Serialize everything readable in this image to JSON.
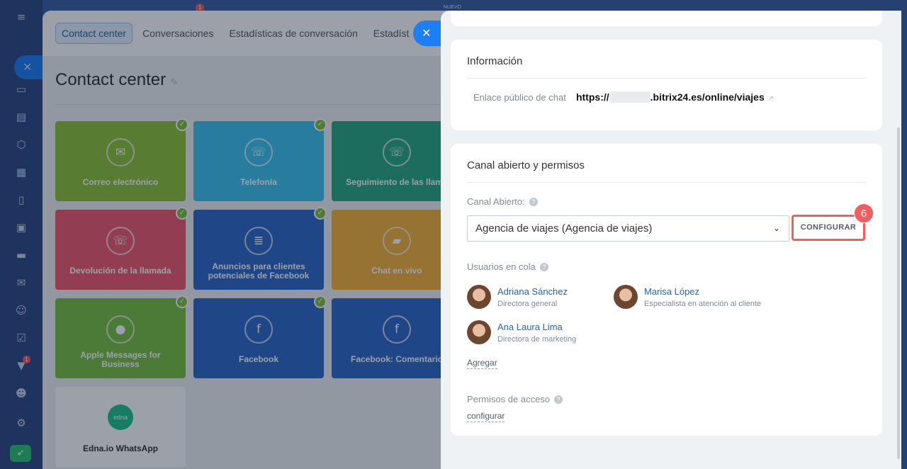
{
  "leftnav": {
    "icons": [
      "menu-icon",
      "close-icon",
      "chat-icon",
      "list-icon",
      "hexagon-icon",
      "calendar-icon",
      "document-icon",
      "projector-icon",
      "card-icon",
      "mail-icon",
      "contacts-icon",
      "check-icon",
      "filter-icon",
      "robot-icon",
      "settings-icon",
      "rocket-icon"
    ],
    "badge": "1"
  },
  "topbar": {
    "badge": "1",
    "new_label": "NUEVO"
  },
  "bg": {
    "tabs": [
      "Contact center",
      "Conversaciones",
      "Estadísticas de conversación",
      "Estadíst"
    ],
    "title": "Contact center",
    "tiles": [
      {
        "label": "Correo electrónico",
        "icon": "✉",
        "checked": true
      },
      {
        "label": "Telefonía",
        "icon": "☏",
        "checked": true
      },
      {
        "label": "Seguimiento de las llama",
        "icon": "☏",
        "checked": false
      },
      {
        "label": "Devolución de la llamada",
        "icon": "☏",
        "checked": true
      },
      {
        "label": "Anuncios para clientes potenciales de Facebook",
        "icon": "≣",
        "checked": true
      },
      {
        "label": "Chat en vivo",
        "icon": "▰",
        "checked": false
      },
      {
        "label": "Apple Messages for Business",
        "icon": "●",
        "checked": true
      },
      {
        "label": "Facebook",
        "icon": "f",
        "checked": true
      },
      {
        "label": "Facebook: Comentario",
        "icon": "f",
        "checked": false
      },
      {
        "label": "Edna.io WhatsApp",
        "icon": "edna",
        "checked": false
      }
    ],
    "edna_logo_text": "edna"
  },
  "slider": {
    "info": {
      "title": "Información",
      "link_label": "Enlace público de chat",
      "link_prefix": "https://",
      "link_suffix": ".bitrix24.es/online/viajes"
    },
    "channel": {
      "title": "Canal abierto y permisos",
      "canal_label": "Canal Abierto:",
      "canal_value": "Agencia de viajes (Agencia de viajes)",
      "configure_button": "CONFIGURAR",
      "step_number": "6",
      "queue_label": "Usuarios en cola",
      "users": [
        {
          "name": "Adriana Sánchez",
          "role": "Directora general"
        },
        {
          "name": "Marisa López",
          "role": "Especialista en atención al cliente"
        },
        {
          "name": "Ana Laura Lima",
          "role": "Directora de marketing"
        }
      ],
      "add_link": "Agregar",
      "perm_label": "Permisos de acceso",
      "perm_link": "configurar"
    }
  },
  "colors": {
    "accent": "#1d7ff3",
    "highlight": "#ef5f5f",
    "link": "#2067b0"
  }
}
